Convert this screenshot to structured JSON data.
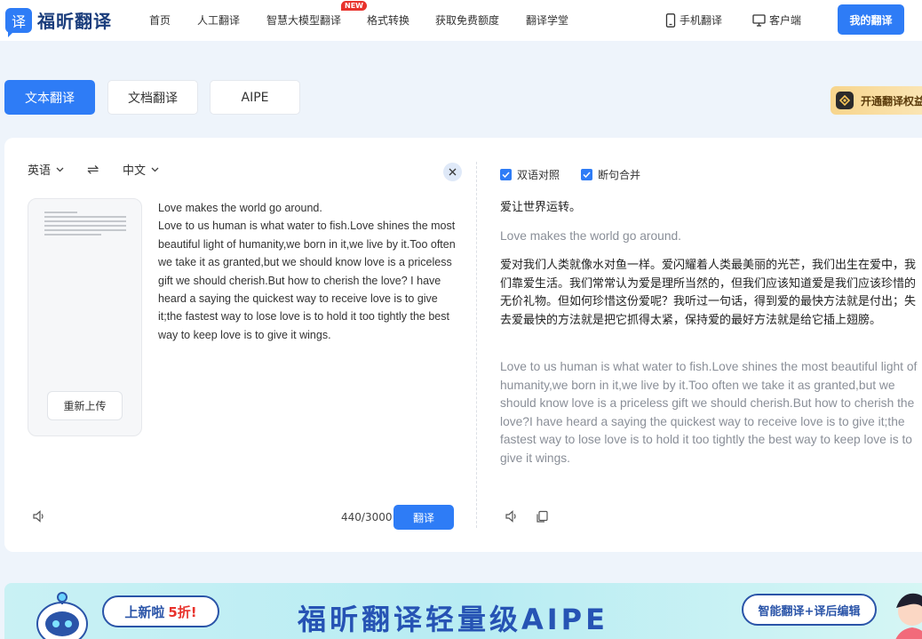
{
  "header": {
    "logo_char": "译",
    "logo_text": "福昕翻译",
    "nav": [
      "首页",
      "人工翻译",
      "智慧大模型翻译",
      "格式转换",
      "获取免费额度",
      "翻译学堂"
    ],
    "new_badge": "NEW",
    "mobile_link": "手机翻译",
    "client_link": "客户端",
    "my_button": "我的翻译"
  },
  "tabs": [
    "文本翻译",
    "文档翻译",
    "AIPE"
  ],
  "vip_label": "开通翻译权益",
  "source": {
    "lang": "英语",
    "target_lang": "中文",
    "swap_symbol": "⇌",
    "reupload": "重新上传",
    "text": "Love makes the world go around.\nLove to us human is what water to fish.Love shines the most beautiful light of humanity,we born in it,we live by it.Too often we take it as granted,but we should know love is a priceless gift we should cherish.But how to cherish the love? I have heard a saying the quickest way to receive love is to give it;the fastest way to lose love is to hold it too tightly the best way to keep love is to give it wings.",
    "count": "440/3000",
    "translate_button": "翻译"
  },
  "output": {
    "bilingual_label": "双语对照",
    "merge_label": "断句合并",
    "blocks": [
      {
        "zh": "爱让世界运转。",
        "en": "Love makes the world go around."
      },
      {
        "zh": "爱对我们人类就像水对鱼一样。爱闪耀着人类最美丽的光芒，我们出生在爱中，我们靠爱生活。我们常常认为爱是理所当然的，但我们应该知道爱是我们应该珍惜的无价礼物。但如何珍惜这份爱呢？我听过一句话，得到爱的最快方法就是付出；失去爱最快的方法就是把它抓得太紧，保持爱的最好方法就是给它插上翅膀。",
        "en": "Love to us human is what water to fish.Love shines the most beautiful light of humanity,we born in it,we live by it.Too often we take it as granted,but we should know love is a priceless gift we should cherish.But how to cherish the love?I have heard a saying the quickest way to receive love is to give it;the fastest way to lose love is to hold it too tightly the best way to keep love is to give it wings."
      }
    ]
  },
  "banner": {
    "bubble_text": "上新啦",
    "bubble_highlight": "5折!",
    "title": "福昕翻译轻量级AIPE",
    "pill": "智能翻译+译后编辑"
  },
  "colors": {
    "primary": "#2e7cf6",
    "banner_text": "#2653b4"
  }
}
